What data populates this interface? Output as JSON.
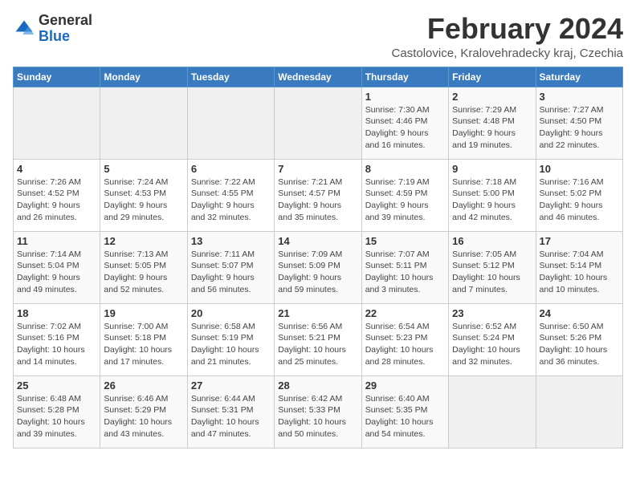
{
  "header": {
    "logo_general": "General",
    "logo_blue": "Blue",
    "month_title": "February 2024",
    "location": "Castolovice, Kralovehradecky kraj, Czechia"
  },
  "weekdays": [
    "Sunday",
    "Monday",
    "Tuesday",
    "Wednesday",
    "Thursday",
    "Friday",
    "Saturday"
  ],
  "weeks": [
    [
      {
        "day": "",
        "info": ""
      },
      {
        "day": "",
        "info": ""
      },
      {
        "day": "",
        "info": ""
      },
      {
        "day": "",
        "info": ""
      },
      {
        "day": "1",
        "info": "Sunrise: 7:30 AM\nSunset: 4:46 PM\nDaylight: 9 hours\nand 16 minutes."
      },
      {
        "day": "2",
        "info": "Sunrise: 7:29 AM\nSunset: 4:48 PM\nDaylight: 9 hours\nand 19 minutes."
      },
      {
        "day": "3",
        "info": "Sunrise: 7:27 AM\nSunset: 4:50 PM\nDaylight: 9 hours\nand 22 minutes."
      }
    ],
    [
      {
        "day": "4",
        "info": "Sunrise: 7:26 AM\nSunset: 4:52 PM\nDaylight: 9 hours\nand 26 minutes."
      },
      {
        "day": "5",
        "info": "Sunrise: 7:24 AM\nSunset: 4:53 PM\nDaylight: 9 hours\nand 29 minutes."
      },
      {
        "day": "6",
        "info": "Sunrise: 7:22 AM\nSunset: 4:55 PM\nDaylight: 9 hours\nand 32 minutes."
      },
      {
        "day": "7",
        "info": "Sunrise: 7:21 AM\nSunset: 4:57 PM\nDaylight: 9 hours\nand 35 minutes."
      },
      {
        "day": "8",
        "info": "Sunrise: 7:19 AM\nSunset: 4:59 PM\nDaylight: 9 hours\nand 39 minutes."
      },
      {
        "day": "9",
        "info": "Sunrise: 7:18 AM\nSunset: 5:00 PM\nDaylight: 9 hours\nand 42 minutes."
      },
      {
        "day": "10",
        "info": "Sunrise: 7:16 AM\nSunset: 5:02 PM\nDaylight: 9 hours\nand 46 minutes."
      }
    ],
    [
      {
        "day": "11",
        "info": "Sunrise: 7:14 AM\nSunset: 5:04 PM\nDaylight: 9 hours\nand 49 minutes."
      },
      {
        "day": "12",
        "info": "Sunrise: 7:13 AM\nSunset: 5:05 PM\nDaylight: 9 hours\nand 52 minutes."
      },
      {
        "day": "13",
        "info": "Sunrise: 7:11 AM\nSunset: 5:07 PM\nDaylight: 9 hours\nand 56 minutes."
      },
      {
        "day": "14",
        "info": "Sunrise: 7:09 AM\nSunset: 5:09 PM\nDaylight: 9 hours\nand 59 minutes."
      },
      {
        "day": "15",
        "info": "Sunrise: 7:07 AM\nSunset: 5:11 PM\nDaylight: 10 hours\nand 3 minutes."
      },
      {
        "day": "16",
        "info": "Sunrise: 7:05 AM\nSunset: 5:12 PM\nDaylight: 10 hours\nand 7 minutes."
      },
      {
        "day": "17",
        "info": "Sunrise: 7:04 AM\nSunset: 5:14 PM\nDaylight: 10 hours\nand 10 minutes."
      }
    ],
    [
      {
        "day": "18",
        "info": "Sunrise: 7:02 AM\nSunset: 5:16 PM\nDaylight: 10 hours\nand 14 minutes."
      },
      {
        "day": "19",
        "info": "Sunrise: 7:00 AM\nSunset: 5:18 PM\nDaylight: 10 hours\nand 17 minutes."
      },
      {
        "day": "20",
        "info": "Sunrise: 6:58 AM\nSunset: 5:19 PM\nDaylight: 10 hours\nand 21 minutes."
      },
      {
        "day": "21",
        "info": "Sunrise: 6:56 AM\nSunset: 5:21 PM\nDaylight: 10 hours\nand 25 minutes."
      },
      {
        "day": "22",
        "info": "Sunrise: 6:54 AM\nSunset: 5:23 PM\nDaylight: 10 hours\nand 28 minutes."
      },
      {
        "day": "23",
        "info": "Sunrise: 6:52 AM\nSunset: 5:24 PM\nDaylight: 10 hours\nand 32 minutes."
      },
      {
        "day": "24",
        "info": "Sunrise: 6:50 AM\nSunset: 5:26 PM\nDaylight: 10 hours\nand 36 minutes."
      }
    ],
    [
      {
        "day": "25",
        "info": "Sunrise: 6:48 AM\nSunset: 5:28 PM\nDaylight: 10 hours\nand 39 minutes."
      },
      {
        "day": "26",
        "info": "Sunrise: 6:46 AM\nSunset: 5:29 PM\nDaylight: 10 hours\nand 43 minutes."
      },
      {
        "day": "27",
        "info": "Sunrise: 6:44 AM\nSunset: 5:31 PM\nDaylight: 10 hours\nand 47 minutes."
      },
      {
        "day": "28",
        "info": "Sunrise: 6:42 AM\nSunset: 5:33 PM\nDaylight: 10 hours\nand 50 minutes."
      },
      {
        "day": "29",
        "info": "Sunrise: 6:40 AM\nSunset: 5:35 PM\nDaylight: 10 hours\nand 54 minutes."
      },
      {
        "day": "",
        "info": ""
      },
      {
        "day": "",
        "info": ""
      }
    ]
  ]
}
